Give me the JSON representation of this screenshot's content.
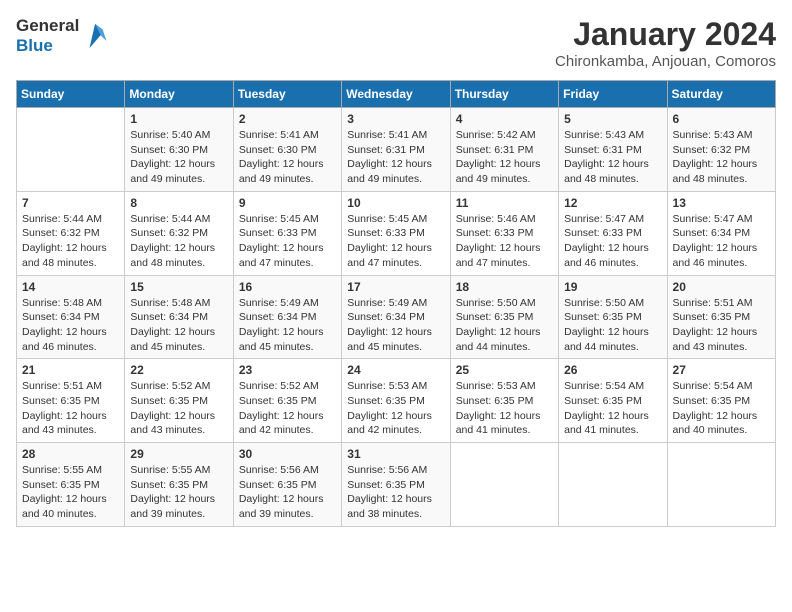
{
  "logo": {
    "text_general": "General",
    "text_blue": "Blue"
  },
  "title": "January 2024",
  "subtitle": "Chironkamba, Anjouan, Comoros",
  "days_of_week": [
    "Sunday",
    "Monday",
    "Tuesday",
    "Wednesday",
    "Thursday",
    "Friday",
    "Saturday"
  ],
  "weeks": [
    [
      {
        "day": "",
        "info": ""
      },
      {
        "day": "1",
        "info": "Sunrise: 5:40 AM\nSunset: 6:30 PM\nDaylight: 12 hours\nand 49 minutes."
      },
      {
        "day": "2",
        "info": "Sunrise: 5:41 AM\nSunset: 6:30 PM\nDaylight: 12 hours\nand 49 minutes."
      },
      {
        "day": "3",
        "info": "Sunrise: 5:41 AM\nSunset: 6:31 PM\nDaylight: 12 hours\nand 49 minutes."
      },
      {
        "day": "4",
        "info": "Sunrise: 5:42 AM\nSunset: 6:31 PM\nDaylight: 12 hours\nand 49 minutes."
      },
      {
        "day": "5",
        "info": "Sunrise: 5:43 AM\nSunset: 6:31 PM\nDaylight: 12 hours\nand 48 minutes."
      },
      {
        "day": "6",
        "info": "Sunrise: 5:43 AM\nSunset: 6:32 PM\nDaylight: 12 hours\nand 48 minutes."
      }
    ],
    [
      {
        "day": "7",
        "info": "Sunrise: 5:44 AM\nSunset: 6:32 PM\nDaylight: 12 hours\nand 48 minutes."
      },
      {
        "day": "8",
        "info": "Sunrise: 5:44 AM\nSunset: 6:32 PM\nDaylight: 12 hours\nand 48 minutes."
      },
      {
        "day": "9",
        "info": "Sunrise: 5:45 AM\nSunset: 6:33 PM\nDaylight: 12 hours\nand 47 minutes."
      },
      {
        "day": "10",
        "info": "Sunrise: 5:45 AM\nSunset: 6:33 PM\nDaylight: 12 hours\nand 47 minutes."
      },
      {
        "day": "11",
        "info": "Sunrise: 5:46 AM\nSunset: 6:33 PM\nDaylight: 12 hours\nand 47 minutes."
      },
      {
        "day": "12",
        "info": "Sunrise: 5:47 AM\nSunset: 6:33 PM\nDaylight: 12 hours\nand 46 minutes."
      },
      {
        "day": "13",
        "info": "Sunrise: 5:47 AM\nSunset: 6:34 PM\nDaylight: 12 hours\nand 46 minutes."
      }
    ],
    [
      {
        "day": "14",
        "info": "Sunrise: 5:48 AM\nSunset: 6:34 PM\nDaylight: 12 hours\nand 46 minutes."
      },
      {
        "day": "15",
        "info": "Sunrise: 5:48 AM\nSunset: 6:34 PM\nDaylight: 12 hours\nand 45 minutes."
      },
      {
        "day": "16",
        "info": "Sunrise: 5:49 AM\nSunset: 6:34 PM\nDaylight: 12 hours\nand 45 minutes."
      },
      {
        "day": "17",
        "info": "Sunrise: 5:49 AM\nSunset: 6:34 PM\nDaylight: 12 hours\nand 45 minutes."
      },
      {
        "day": "18",
        "info": "Sunrise: 5:50 AM\nSunset: 6:35 PM\nDaylight: 12 hours\nand 44 minutes."
      },
      {
        "day": "19",
        "info": "Sunrise: 5:50 AM\nSunset: 6:35 PM\nDaylight: 12 hours\nand 44 minutes."
      },
      {
        "day": "20",
        "info": "Sunrise: 5:51 AM\nSunset: 6:35 PM\nDaylight: 12 hours\nand 43 minutes."
      }
    ],
    [
      {
        "day": "21",
        "info": "Sunrise: 5:51 AM\nSunset: 6:35 PM\nDaylight: 12 hours\nand 43 minutes."
      },
      {
        "day": "22",
        "info": "Sunrise: 5:52 AM\nSunset: 6:35 PM\nDaylight: 12 hours\nand 43 minutes."
      },
      {
        "day": "23",
        "info": "Sunrise: 5:52 AM\nSunset: 6:35 PM\nDaylight: 12 hours\nand 42 minutes."
      },
      {
        "day": "24",
        "info": "Sunrise: 5:53 AM\nSunset: 6:35 PM\nDaylight: 12 hours\nand 42 minutes."
      },
      {
        "day": "25",
        "info": "Sunrise: 5:53 AM\nSunset: 6:35 PM\nDaylight: 12 hours\nand 41 minutes."
      },
      {
        "day": "26",
        "info": "Sunrise: 5:54 AM\nSunset: 6:35 PM\nDaylight: 12 hours\nand 41 minutes."
      },
      {
        "day": "27",
        "info": "Sunrise: 5:54 AM\nSunset: 6:35 PM\nDaylight: 12 hours\nand 40 minutes."
      }
    ],
    [
      {
        "day": "28",
        "info": "Sunrise: 5:55 AM\nSunset: 6:35 PM\nDaylight: 12 hours\nand 40 minutes."
      },
      {
        "day": "29",
        "info": "Sunrise: 5:55 AM\nSunset: 6:35 PM\nDaylight: 12 hours\nand 39 minutes."
      },
      {
        "day": "30",
        "info": "Sunrise: 5:56 AM\nSunset: 6:35 PM\nDaylight: 12 hours\nand 39 minutes."
      },
      {
        "day": "31",
        "info": "Sunrise: 5:56 AM\nSunset: 6:35 PM\nDaylight: 12 hours\nand 38 minutes."
      },
      {
        "day": "",
        "info": ""
      },
      {
        "day": "",
        "info": ""
      },
      {
        "day": "",
        "info": ""
      }
    ]
  ]
}
